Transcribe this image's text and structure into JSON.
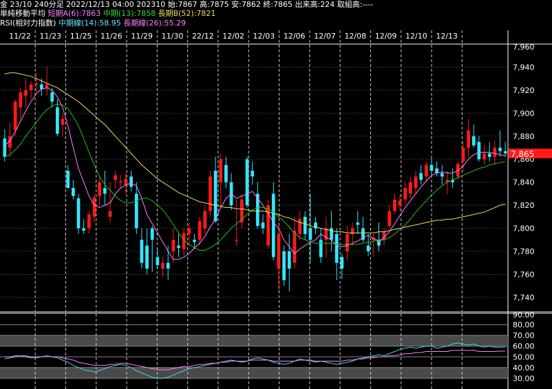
{
  "header": {
    "line1": "金 23/10 240分足 2022/12/13 04:00 202310 始:7867 高:7875 安:7862 終:7865 出来高:224 取組高:----",
    "ma_title": "単純移動平均",
    "ma_short": "短期A(6):7863",
    "ma_mid": "中期(13):7858",
    "ma_long": "長期B(52):7821",
    "rsi_title": "RSI(相対力指数)",
    "rsi_mid": "中期線(14):58.95",
    "rsi_long": "長期線(26):55.29"
  },
  "colors": {
    "up": "#ff1a1a",
    "down": "#33e6ff",
    "ma_short": "#ff80ff",
    "ma_mid": "#22c022",
    "ma_long": "#e8e060",
    "rsi_mid": "#44d8e8",
    "rsi_long": "#ff80ff",
    "last_price_bg": "#ff1a1a"
  },
  "chart_data": [
    {
      "type": "candlestick",
      "x_labels": [
        "11/22",
        "11/23",
        "11/25",
        "11/26",
        "11/29",
        "11/30",
        "22/12",
        "12/02",
        "12/03",
        "12/06",
        "12/07",
        "12/08",
        "12/09",
        "12/10",
        "12/13"
      ],
      "y_ticks": [
        7740,
        7760,
        7780,
        7800,
        7820,
        7840,
        7860,
        7880,
        7900,
        7920,
        7940
      ],
      "y_top_label": "7,960",
      "ylim": [
        7728,
        7960
      ],
      "last_price": "7,865",
      "ohlc": [
        [
          7878,
          7886,
          7858,
          7862
        ],
        [
          7870,
          7892,
          7862,
          7880
        ],
        [
          7885,
          7912,
          7880,
          7910
        ],
        [
          7905,
          7922,
          7895,
          7918
        ],
        [
          7915,
          7930,
          7905,
          7920
        ],
        [
          7920,
          7928,
          7912,
          7925
        ],
        [
          7925,
          7935,
          7918,
          7926
        ],
        [
          7925,
          7930,
          7915,
          7921
        ],
        [
          7922,
          7940,
          7915,
          7925
        ],
        [
          7918,
          7922,
          7905,
          7910
        ],
        [
          7905,
          7912,
          7880,
          7882
        ],
        [
          7890,
          7900,
          7880,
          7895
        ],
        [
          7850,
          7855,
          7840,
          7835
        ],
        [
          7835,
          7842,
          7825,
          7828
        ],
        [
          7826,
          7830,
          7795,
          7800
        ],
        [
          7800,
          7808,
          7795,
          7798
        ],
        [
          7800,
          7815,
          7795,
          7812
        ],
        [
          7810,
          7830,
          7805,
          7827
        ],
        [
          7828,
          7845,
          7820,
          7840
        ],
        [
          7835,
          7850,
          7820,
          7830
        ],
        [
          7810,
          7840,
          7805,
          7815
        ],
        [
          7842,
          7850,
          7835,
          7846
        ],
        [
          7840,
          7846,
          7835,
          7841
        ],
        [
          7838,
          7848,
          7830,
          7843
        ],
        [
          7845,
          7850,
          7832,
          7836
        ],
        [
          7830,
          7840,
          7795,
          7800
        ],
        [
          7790,
          7800,
          7765,
          7770
        ],
        [
          7785,
          7800,
          7760,
          7765
        ],
        [
          7800,
          7802,
          7762,
          7790
        ],
        [
          7775,
          7782,
          7765,
          7768
        ],
        [
          7765,
          7775,
          7758,
          7770
        ],
        [
          7770,
          7785,
          7755,
          7765
        ],
        [
          7780,
          7800,
          7770,
          7790
        ],
        [
          7785,
          7795,
          7775,
          7783
        ],
        [
          7782,
          7800,
          7776,
          7796
        ],
        [
          7795,
          7805,
          7785,
          7800
        ],
        [
          7790,
          7795,
          7782,
          7788
        ],
        [
          7790,
          7810,
          7785,
          7806
        ],
        [
          7800,
          7820,
          7795,
          7815
        ],
        [
          7815,
          7850,
          7810,
          7845
        ],
        [
          7850,
          7862,
          7805,
          7806
        ],
        [
          7840,
          7865,
          7818,
          7860
        ],
        [
          7855,
          7862,
          7835,
          7840
        ],
        [
          7840,
          7848,
          7816,
          7820
        ],
        [
          7790,
          7825,
          7785,
          7790
        ],
        [
          7805,
          7830,
          7800,
          7825
        ],
        [
          7860,
          7862,
          7818,
          7820
        ],
        [
          7850,
          7858,
          7838,
          7845
        ],
        [
          7830,
          7840,
          7800,
          7802
        ],
        [
          7805,
          7812,
          7795,
          7800
        ],
        [
          7785,
          7825,
          7782,
          7820
        ],
        [
          7830,
          7840,
          7772,
          7775
        ],
        [
          7765,
          7805,
          7745,
          7795
        ],
        [
          7780,
          7785,
          7750,
          7755
        ],
        [
          7780,
          7795,
          7745,
          7765
        ],
        [
          7770,
          7810,
          7765,
          7798
        ],
        [
          7795,
          7815,
          7790,
          7808
        ],
        [
          7810,
          7815,
          7790,
          7795
        ],
        [
          7800,
          7830,
          7770,
          7790
        ],
        [
          7805,
          7810,
          7795,
          7800
        ],
        [
          7790,
          7800,
          7770,
          7775
        ],
        [
          7790,
          7810,
          7775,
          7800
        ],
        [
          7800,
          7815,
          7780,
          7790
        ],
        [
          7795,
          7800,
          7755,
          7770
        ],
        [
          7775,
          7778,
          7756,
          7765
        ],
        [
          7780,
          7802,
          7772,
          7795
        ],
        [
          7795,
          7805,
          7785,
          7800
        ],
        [
          7805,
          7815,
          7795,
          7803
        ],
        [
          7800,
          7810,
          7788,
          7790
        ],
        [
          7785,
          7795,
          7776,
          7780
        ],
        [
          7790,
          7795,
          7775,
          7792
        ],
        [
          7790,
          7805,
          7780,
          7785
        ],
        [
          7790,
          7800,
          7785,
          7797
        ],
        [
          7802,
          7820,
          7800,
          7815
        ],
        [
          7815,
          7830,
          7812,
          7825
        ],
        [
          7820,
          7830,
          7815,
          7824
        ],
        [
          7825,
          7840,
          7820,
          7835
        ],
        [
          7830,
          7845,
          7825,
          7840
        ],
        [
          7835,
          7850,
          7830,
          7845
        ],
        [
          7848,
          7855,
          7838,
          7842
        ],
        [
          7845,
          7858,
          7840,
          7855
        ],
        [
          7855,
          7862,
          7845,
          7850
        ],
        [
          7852,
          7858,
          7845,
          7848
        ],
        [
          7848,
          7855,
          7838,
          7845
        ],
        [
          7840,
          7850,
          7830,
          7842
        ],
        [
          7842,
          7852,
          7835,
          7840
        ],
        [
          7845,
          7858,
          7842,
          7856
        ],
        [
          7858,
          7875,
          7850,
          7870
        ],
        [
          7870,
          7895,
          7862,
          7885
        ],
        [
          7880,
          7890,
          7870,
          7872
        ],
        [
          7875,
          7880,
          7858,
          7860
        ],
        [
          7860,
          7872,
          7855,
          7865
        ],
        [
          7865,
          7875,
          7858,
          7862
        ],
        [
          7862,
          7876,
          7855,
          7870
        ],
        [
          7870,
          7885,
          7862,
          7867
        ],
        [
          7867,
          7875,
          7862,
          7865
        ]
      ],
      "series": [
        {
          "name": "短期A(6)",
          "values": [
            7872,
            7876,
            7884,
            7893,
            7902,
            7910,
            7917,
            7921,
            7922,
            7920,
            7914,
            7905,
            7889,
            7870,
            7852,
            7840,
            7828,
            7820,
            7818,
            7820,
            7822,
            7830,
            7835,
            7838,
            7839,
            7837,
            7826,
            7812,
            7804,
            7796,
            7788,
            7780,
            7773,
            7773,
            7775,
            7778,
            7783,
            7787,
            7793,
            7801,
            7808,
            7818,
            7826,
            7830,
            7826,
            7828,
            7830,
            7832,
            7826,
            7820,
            7813,
            7805,
            7800,
            7790,
            7784,
            7778,
            7782,
            7785,
            7788,
            7790,
            7795,
            7792,
            7790,
            7785,
            7784,
            7785,
            7787,
            7789,
            7792,
            7794,
            7791,
            7789,
            7792,
            7797,
            7804,
            7811,
            7818,
            7824,
            7830,
            7836,
            7841,
            7846,
            7848,
            7849,
            7848,
            7848,
            7850,
            7854,
            7860,
            7864,
            7866,
            7866,
            7866,
            7865,
            7864,
            7863
          ]
        },
        {
          "name": "中期(13)",
          "values": [
            7862,
            7864,
            7868,
            7873,
            7880,
            7886,
            7892,
            7898,
            7903,
            7906,
            7908,
            7907,
            7904,
            7897,
            7889,
            7878,
            7866,
            7855,
            7845,
            7838,
            7833,
            7828,
            7824,
            7822,
            7822,
            7824,
            7826,
            7826,
            7824,
            7820,
            7816,
            7810,
            7803,
            7796,
            7790,
            7786,
            7783,
            7781,
            7781,
            7783,
            7786,
            7790,
            7795,
            7800,
            7804,
            7808,
            7812,
            7816,
            7818,
            7818,
            7817,
            7814,
            7810,
            7806,
            7801,
            7796,
            7792,
            7790,
            7788,
            7787,
            7787,
            7787,
            7787,
            7786,
            7786,
            7786,
            7786,
            7786,
            7787,
            7788,
            7789,
            7789,
            7790,
            7792,
            7795,
            7799,
            7803,
            7808,
            7814,
            7819,
            7824,
            7829,
            7833,
            7837,
            7840,
            7842,
            7844,
            7846,
            7848,
            7850,
            7852,
            7853,
            7855,
            7856,
            7857,
            7858
          ]
        },
        {
          "name": "長期B(52)",
          "values": [
            7934,
            7935,
            7935,
            7934,
            7933,
            7932,
            7930,
            7928,
            7926,
            7924,
            7922,
            7919,
            7916,
            7913,
            7910,
            7906,
            7902,
            7898,
            7894,
            7890,
            7885,
            7880,
            7875,
            7870,
            7865,
            7860,
            7855,
            7851,
            7847,
            7843,
            7840,
            7837,
            7834,
            7831,
            7829,
            7827,
            7825,
            7823,
            7822,
            7821,
            7820,
            7819,
            7818,
            7818,
            7817,
            7817,
            7816,
            7815,
            7815,
            7815,
            7814,
            7813,
            7812,
            7810,
            7809,
            7807,
            7805,
            7804,
            7802,
            7801,
            7800,
            7799,
            7798,
            7797,
            7797,
            7796,
            7796,
            7796,
            7796,
            7796,
            7796,
            7797,
            7797,
            7798,
            7799,
            7800,
            7801,
            7802,
            7803,
            7804,
            7805,
            7806,
            7807,
            7807,
            7808,
            7808,
            7809,
            7810,
            7811,
            7812,
            7813,
            7814,
            7816,
            7818,
            7820,
            7821
          ]
        }
      ]
    },
    {
      "type": "line",
      "title": "RSI",
      "y_ticks": [
        30,
        40,
        50,
        60,
        70,
        80
      ],
      "y_tick_labels": [
        "30.00",
        "40.00",
        "50.00",
        "60.00",
        "70.00",
        "80.00"
      ],
      "y_top_label": "90.00",
      "ylim": [
        20,
        90
      ],
      "shaded_bands": [
        [
          30,
          40
        ],
        [
          60,
          70
        ]
      ],
      "series": [
        {
          "name": "中期線(14)",
          "values": [
            48,
            49,
            50,
            51,
            50,
            49,
            49,
            50,
            51,
            50,
            49,
            47,
            45,
            42,
            40,
            38,
            37,
            36,
            37,
            39,
            41,
            42,
            43,
            42,
            40,
            37,
            35,
            33,
            31,
            30,
            30,
            31,
            33,
            35,
            37,
            39,
            40,
            41,
            42,
            43,
            44,
            45,
            46,
            47,
            46,
            45,
            46,
            48,
            49,
            48,
            47,
            45,
            44,
            43,
            44,
            46,
            48,
            47,
            46,
            45,
            46,
            45,
            44,
            43,
            44,
            45,
            46,
            48,
            49,
            50,
            51,
            52,
            51,
            53,
            55,
            57,
            58,
            59,
            58,
            59,
            60,
            60,
            58,
            59,
            60,
            62,
            63,
            62,
            61,
            62,
            60,
            59,
            60,
            59,
            58.95,
            58.95
          ]
        },
        {
          "name": "長期線(26)",
          "values": [
            50,
            50,
            51,
            51,
            51,
            50,
            50,
            50,
            51,
            50,
            50,
            49,
            48,
            47,
            45,
            44,
            43,
            42,
            42,
            42,
            43,
            43,
            44,
            44,
            43,
            42,
            41,
            40,
            39,
            38,
            38,
            38,
            39,
            40,
            41,
            41,
            42,
            43,
            43,
            44,
            44,
            45,
            45,
            46,
            46,
            46,
            46,
            47,
            47,
            47,
            47,
            46,
            46,
            46,
            46,
            46,
            47,
            47,
            47,
            46,
            46,
            46,
            46,
            46,
            46,
            47,
            47,
            48,
            48,
            49,
            49,
            50,
            50,
            51,
            51,
            52,
            53,
            53,
            54,
            54,
            55,
            55,
            55,
            55,
            55,
            56,
            56,
            56,
            56,
            56,
            55,
            55,
            55,
            55,
            55.29,
            55.29
          ]
        }
      ]
    }
  ]
}
